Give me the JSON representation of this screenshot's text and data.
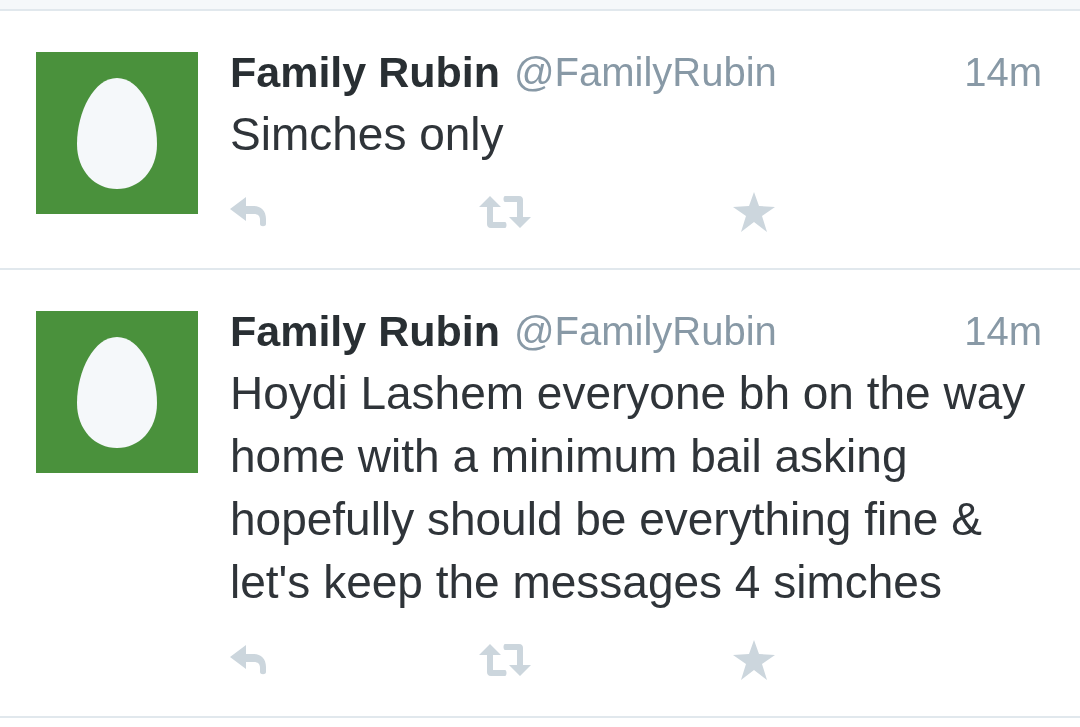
{
  "tweets": [
    {
      "name": "Family Rubin",
      "handle": "@FamilyRubin",
      "time": "14m",
      "text": "Simches only"
    },
    {
      "name": "Family Rubin",
      "handle": "@FamilyRubin",
      "time": "14m",
      "text": "Hoydi Lashem everyone bh on the way home with a minimum bail asking hopefully should be everything fine & let's keep the messages 4 simches"
    }
  ]
}
